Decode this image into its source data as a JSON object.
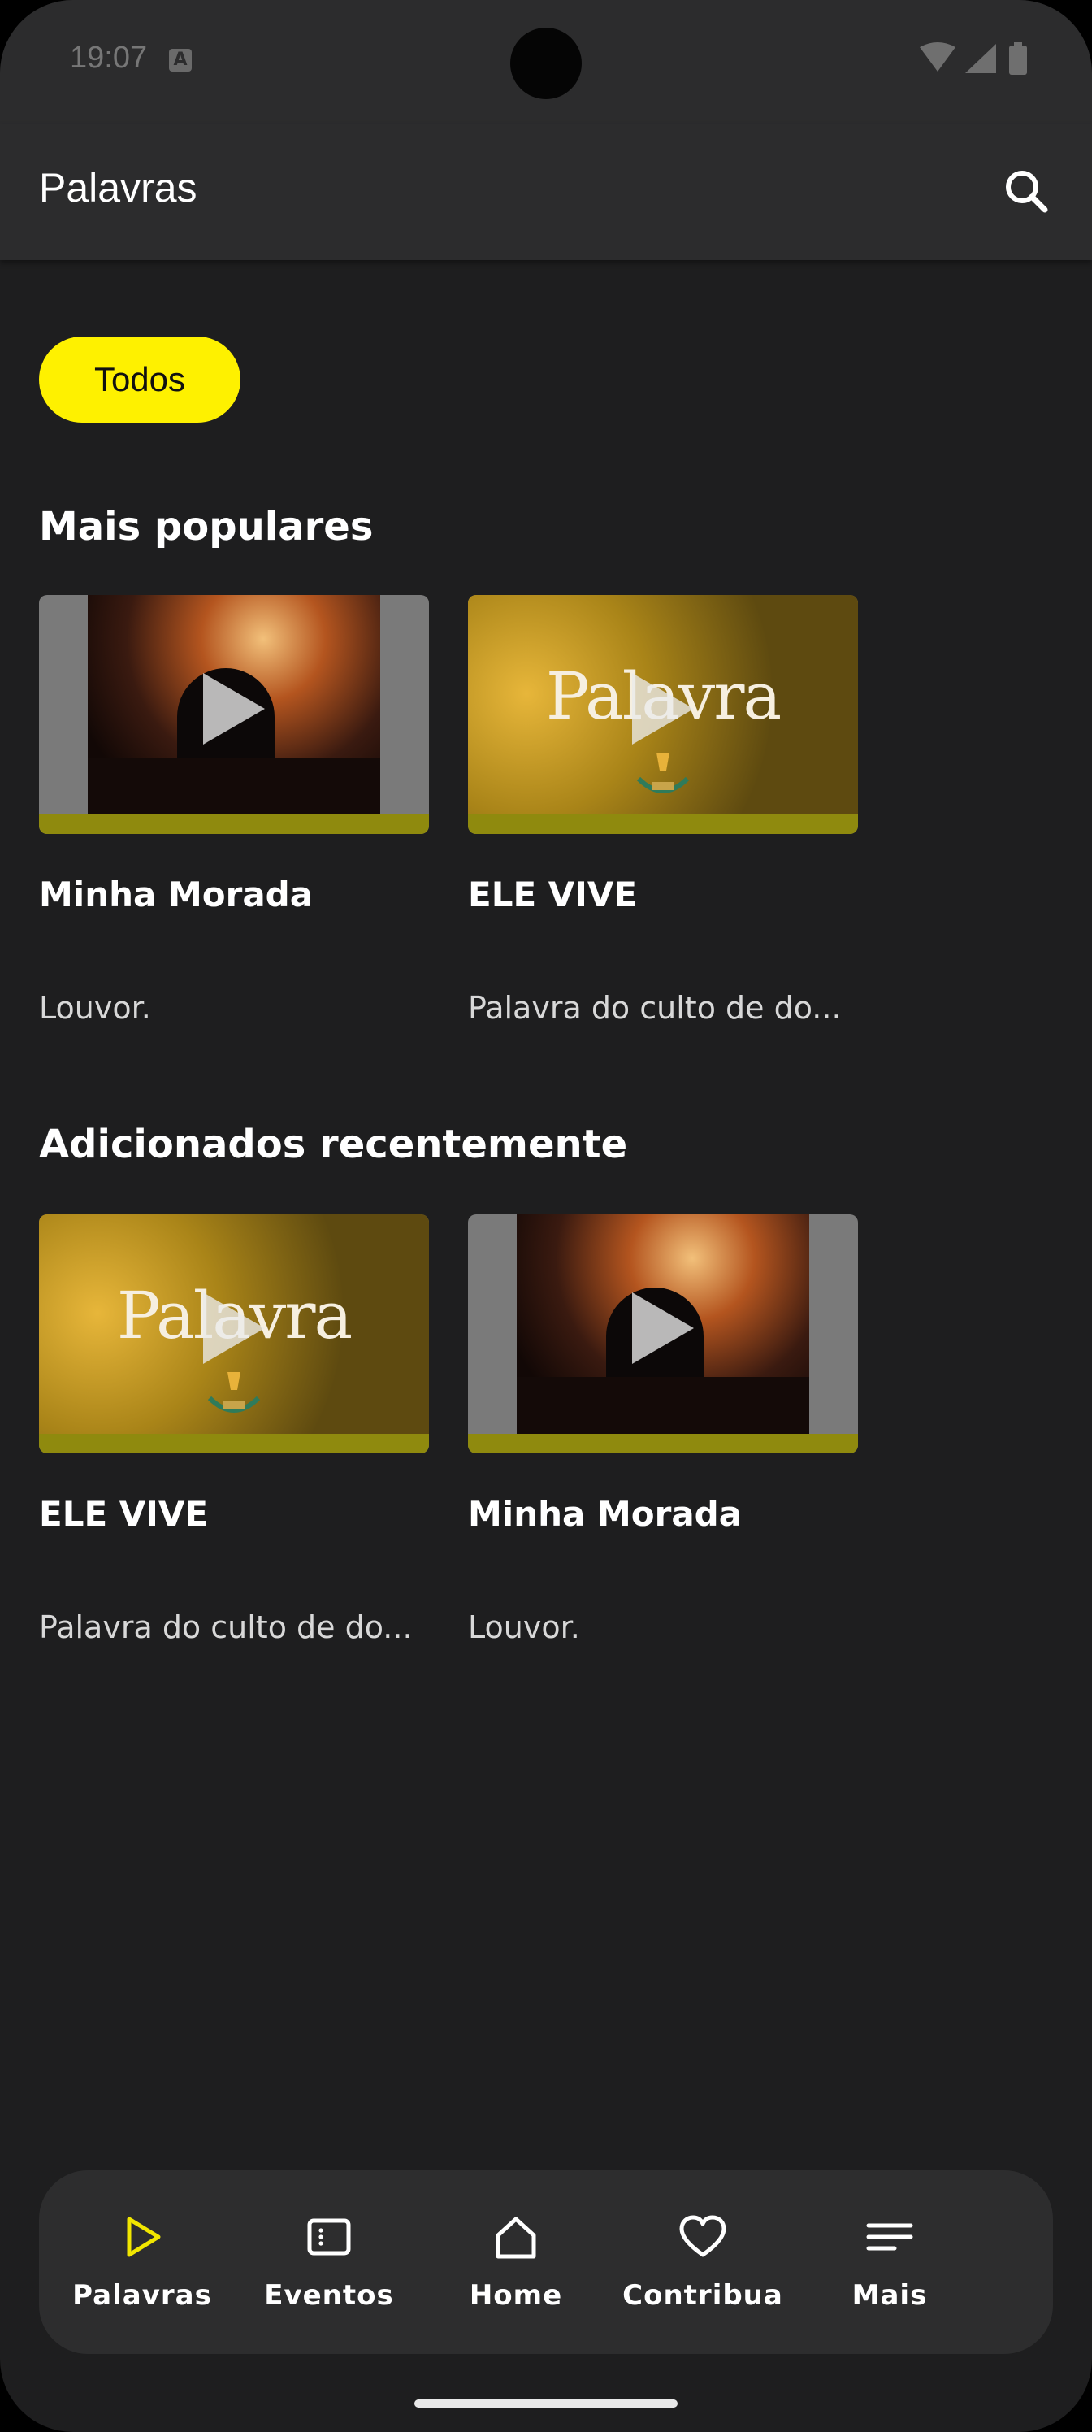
{
  "status_bar": {
    "time": "19:07",
    "a_badge": "A"
  },
  "app_bar": {
    "title": "Palavras"
  },
  "filter_chip": {
    "label": "Todos",
    "color": "#fef100"
  },
  "sections": {
    "popular": {
      "title": "Mais populares",
      "cards": [
        {
          "title": "Minha Morada",
          "subtitle": "Louvor.",
          "thumbnail": "concert-photo"
        },
        {
          "title": "ELE VIVE",
          "subtitle": "Palavra do culto de do...",
          "thumbnail": "palavra-banner",
          "banner_text": "Palavra"
        }
      ]
    },
    "recent": {
      "title": "Adicionados recentemente",
      "cards": [
        {
          "title": "ELE VIVE",
          "subtitle": "Palavra do culto de do...",
          "thumbnail": "palavra-banner",
          "banner_text": "Palavra"
        },
        {
          "title": "Minha Morada",
          "subtitle": "Louvor.",
          "thumbnail": "concert-photo"
        }
      ]
    }
  },
  "bottom_nav": {
    "items": [
      {
        "label": "Palavras",
        "icon": "play-icon",
        "active": true
      },
      {
        "label": "Eventos",
        "icon": "event-card-icon",
        "active": false
      },
      {
        "label": "Home",
        "icon": "home-icon",
        "active": false
      },
      {
        "label": "Contribua",
        "icon": "heart-icon",
        "active": false
      },
      {
        "label": "Mais",
        "icon": "menu-icon",
        "active": false
      }
    ],
    "active_color": "#f1e600"
  }
}
